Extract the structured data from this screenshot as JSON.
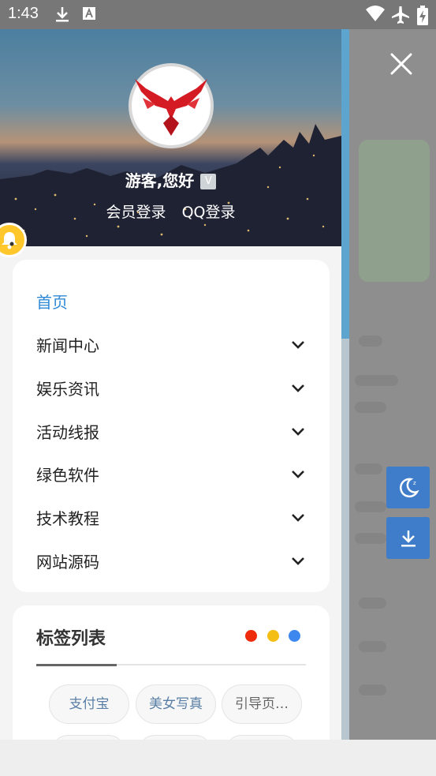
{
  "status_bar": {
    "time": "1:43",
    "icons": [
      "download-icon",
      "text-icon",
      "wifi-icon",
      "airplane-mode-icon",
      "battery-charging-icon"
    ]
  },
  "header": {
    "greeting": "游客,您好",
    "badge": "V",
    "member_login": "会员登录",
    "qq_login": "QQ登录"
  },
  "menu": {
    "items": [
      {
        "label": "首页",
        "active": true,
        "expandable": false
      },
      {
        "label": "新闻中心",
        "expandable": true
      },
      {
        "label": "娱乐资讯",
        "expandable": true
      },
      {
        "label": "活动线报",
        "expandable": true
      },
      {
        "label": "绿色软件",
        "expandable": true
      },
      {
        "label": "技术教程",
        "expandable": true
      },
      {
        "label": "网站源码",
        "expandable": true
      }
    ]
  },
  "tags": {
    "title": "标签列表",
    "dots": [
      "#ee2c0c",
      "#f5be14",
      "#3d88ee"
    ],
    "items": [
      "支付宝",
      "美女写真",
      "引导页…"
    ]
  },
  "colors": {
    "accent": "#2f88d6",
    "float_button": "#3f7cc9",
    "tag_text": "#5a7fa6"
  }
}
